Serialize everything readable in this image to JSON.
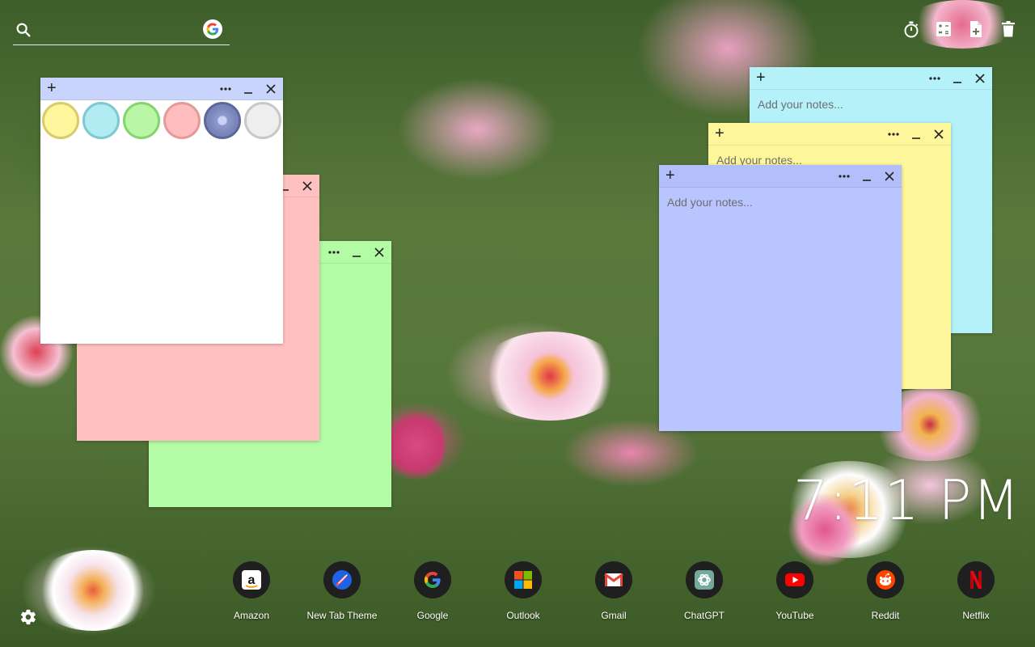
{
  "search": {
    "placeholder": "",
    "icon": "search-icon",
    "google_icon": "google-g-icon"
  },
  "toolbar": {
    "items": [
      {
        "icon": "stopwatch-icon"
      },
      {
        "icon": "calculator-icon"
      },
      {
        "icon": "new-note-icon"
      },
      {
        "icon": "trash-icon"
      }
    ]
  },
  "notes": {
    "placeholder": "Add your notes...",
    "add_label": "+",
    "menu_label": "•••",
    "minimize_label": "_",
    "close_label": "×"
  },
  "palette": {
    "colors": [
      {
        "name": "yellow",
        "fill": "#fff59d",
        "border": "#d7cc6a"
      },
      {
        "name": "blue",
        "fill": "#b2ebf2",
        "border": "#7cc9d3"
      },
      {
        "name": "green",
        "fill": "#b9f6a5",
        "border": "#86d46f"
      },
      {
        "name": "pink",
        "fill": "#ffbdbd",
        "border": "#e39a9a"
      },
      {
        "name": "lavender",
        "fill": "#7985b8",
        "border": "#5d6898"
      },
      {
        "name": "white",
        "fill": "#eeeeee",
        "border": "#c8c8c8"
      }
    ]
  },
  "note_colors": {
    "white": "#ffffff",
    "pink": "#ffc0c0",
    "green": "#b3fba5",
    "cyan": "#b4f1f9",
    "yellow": "#fef69a",
    "lavender": "#b8c5fe",
    "header_white": "#c9d4fc",
    "header_lavender": "#b3bffa"
  },
  "clock": {
    "time": "7:11 PM"
  },
  "shortcuts": [
    {
      "label": "Amazon",
      "icon": "amazon-icon"
    },
    {
      "label": "New Tab Theme",
      "icon": "new-tab-theme-icon"
    },
    {
      "label": "Google",
      "icon": "google-icon"
    },
    {
      "label": "Outlook",
      "icon": "microsoft-icon"
    },
    {
      "label": "Gmail",
      "icon": "gmail-icon"
    },
    {
      "label": "ChatGPT",
      "icon": "chatgpt-icon"
    },
    {
      "label": "YouTube",
      "icon": "youtube-icon"
    },
    {
      "label": "Reddit",
      "icon": "reddit-icon"
    },
    {
      "label": "Netflix",
      "icon": "netflix-icon"
    }
  ],
  "settings": {
    "icon": "gear-icon"
  }
}
